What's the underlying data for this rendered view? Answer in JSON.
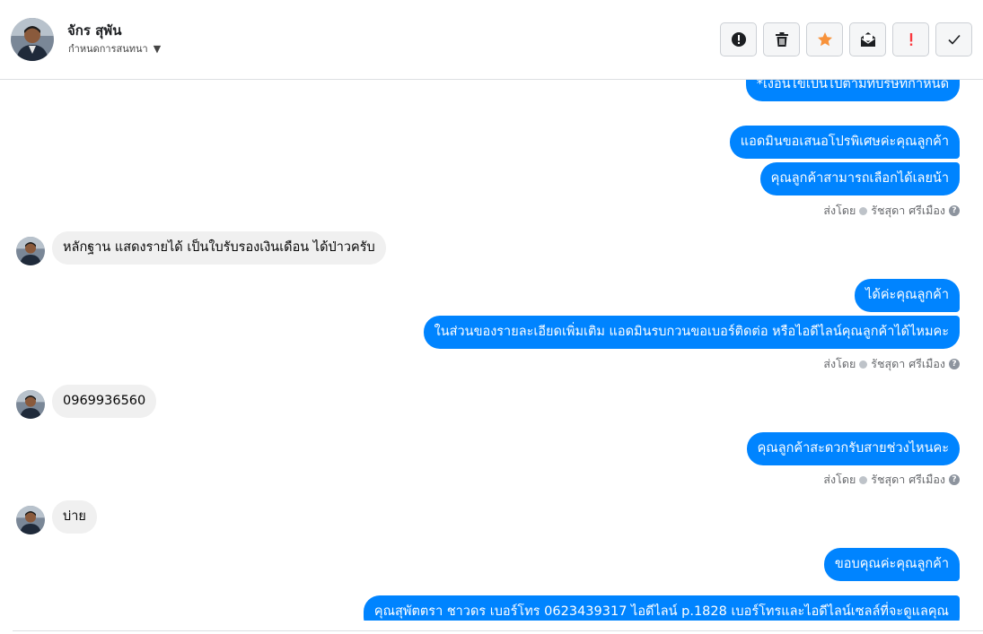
{
  "header": {
    "name": "จักร สุพัน",
    "subtitle": "กำหนดการสนทนา",
    "toolbar": [
      {
        "icon": "alert-circle-icon",
        "name": "mark-spam-button"
      },
      {
        "icon": "trash-icon",
        "name": "delete-button"
      },
      {
        "icon": "star-icon",
        "name": "star-button"
      },
      {
        "icon": "mark-unread-icon",
        "name": "mark-unread-button"
      },
      {
        "icon": "exclamation-icon",
        "name": "follow-up-button"
      },
      {
        "icon": "check-icon",
        "name": "mark-done-button"
      }
    ]
  },
  "messages": {
    "out1_partial": "*เงื่อนไขเป็นไปตามที่บริษัทกำหนด",
    "out2": "แอดมินขอเสนอโปรพิเศษค่ะคุณลูกค้า",
    "out3": "คุณลูกค้าสามารถเลือกได้เลยน้า",
    "sent1": "ส่งโดย",
    "sender1": "รัชสุดา ศรีเมือง",
    "in1": "หลักฐาน แสดงรายได้ เป็นใบรับรองเงินเดือน ได้ป่าวครับ",
    "out4": "ได้ค่ะคุณลูกค้า",
    "out5": "ในส่วนของรายละเอียดเพิ่มเติม แอดมินรบกวนขอเบอร์ติดต่อ หรือไอดีไลน์คุณลูกค้าได้ไหมคะ",
    "sent2": "ส่งโดย",
    "sender2": "รัชสุดา ศรีเมือง",
    "in2": "0969936560",
    "out6": "คุณลูกค้าสะดวกรับสายช่วงไหนคะ",
    "sent3": "ส่งโดย",
    "sender3": "รัชสุดา ศรีเมือง",
    "in3": "บ่าย",
    "out7": "ขอบคุณค่ะคุณลูกค้า",
    "out8_partial": "คุณสุพัตตรา   ชาวดร      เบอร์โทร 0623439317  ไอดีไลน์ p.1828   เบอร์โทรและไอดีไลน์เซลล์ที่จะดูแลคุณ"
  },
  "colors": {
    "outgoing": "#0084ff",
    "incoming": "#f0f0f0",
    "star": "#f7923b",
    "alert": "#fa383e"
  }
}
